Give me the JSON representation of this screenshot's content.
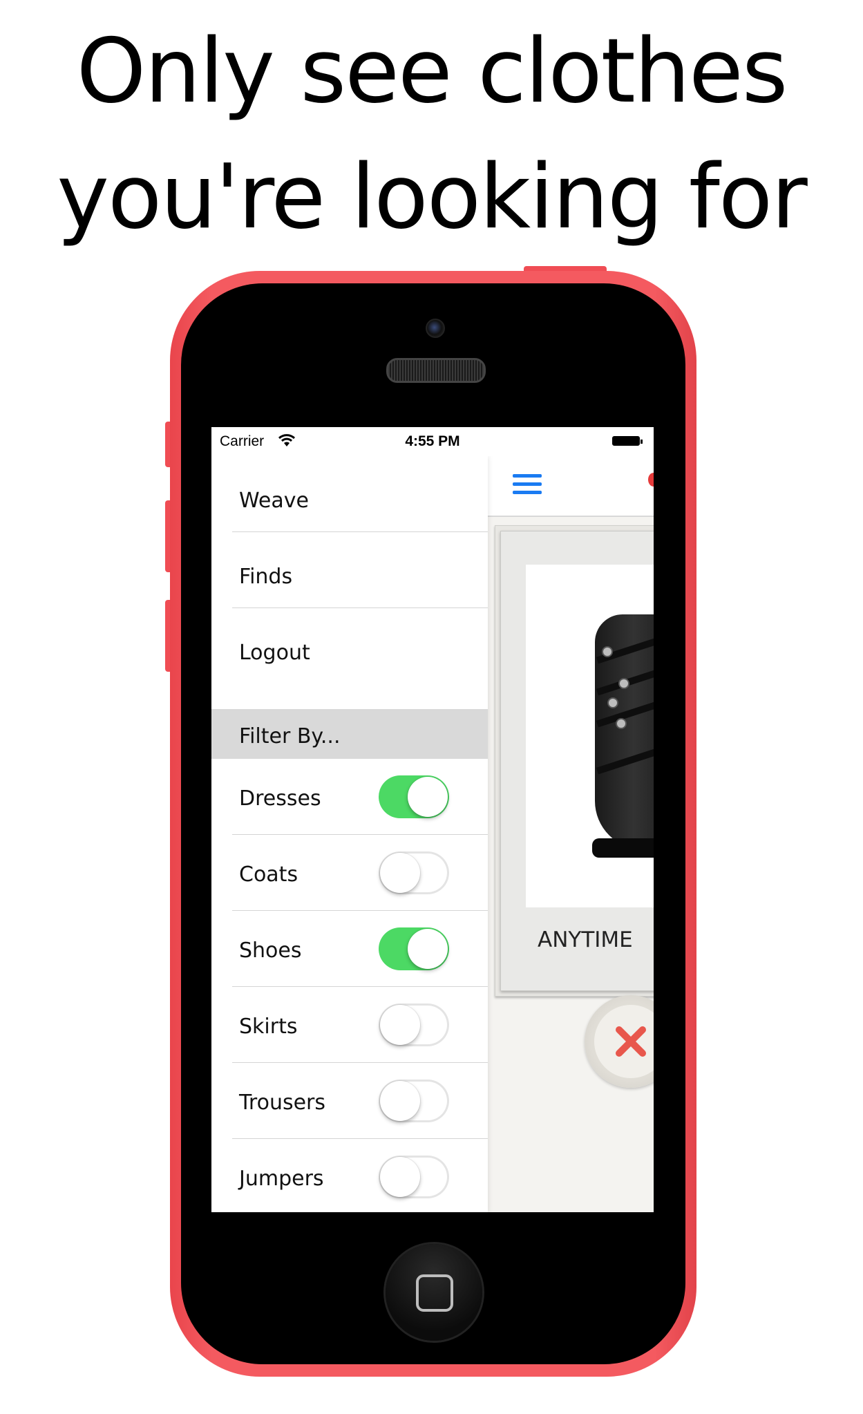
{
  "headline": {
    "line1": "Only see clothes",
    "line2": "you're looking for"
  },
  "phone_color": "#f45a60",
  "statusbar": {
    "carrier": "Carrier",
    "time": "4:55 PM"
  },
  "menu": {
    "items": [
      {
        "label": "Weave"
      },
      {
        "label": "Finds"
      },
      {
        "label": "Logout"
      }
    ],
    "filter_header": "Filter By...",
    "filters": [
      {
        "label": "Dresses",
        "on": true
      },
      {
        "label": "Coats",
        "on": false
      },
      {
        "label": "Shoes",
        "on": true
      },
      {
        "label": "Skirts",
        "on": false
      },
      {
        "label": "Trousers",
        "on": false
      },
      {
        "label": "Jumpers",
        "on": false
      }
    ],
    "toggle_on_color": "#4cd964"
  },
  "content": {
    "menu_icon": "hamburger-icon",
    "card_caption": "ANYTIME",
    "reject_icon": "close-icon",
    "accent": "#1a7bf2"
  }
}
